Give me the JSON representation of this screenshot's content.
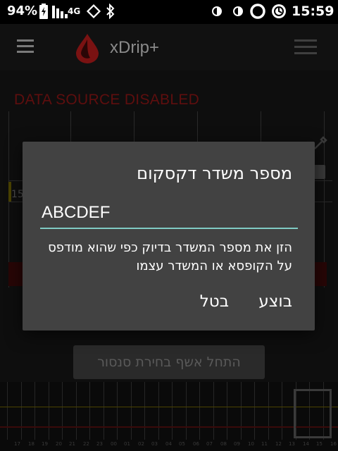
{
  "status_bar": {
    "battery_percent": "94%",
    "network": "4G",
    "time": "15:59"
  },
  "app_bar": {
    "title": "xDrip+"
  },
  "main": {
    "data_source_status": "DATA SOURCE DISABLED",
    "y_axis_label": "15",
    "scan_button_label": "התחל אשף בחירת סנסור",
    "mini_chart_hours": [
      "17",
      "18",
      "19",
      "20",
      "21",
      "22",
      "23",
      "00",
      "01",
      "02",
      "03",
      "04",
      "05",
      "06",
      "07",
      "08",
      "09",
      "10",
      "11",
      "12",
      "13",
      "14",
      "15",
      "16"
    ]
  },
  "dialog": {
    "title": "מספר משדר דקסקום",
    "input_value": "ABCDEF",
    "message": "הזן את מספר המשדר בדיוק כפי שהוא מודפס על הקופסא או המשדר עצמו",
    "ok_label": "בוצע",
    "cancel_label": "בטל"
  },
  "colors": {
    "dialog_bg": "#424242",
    "input_underline": "#80cbc4",
    "status_disabled": "#5e0e0e",
    "logo_red": "#b71c1c"
  }
}
